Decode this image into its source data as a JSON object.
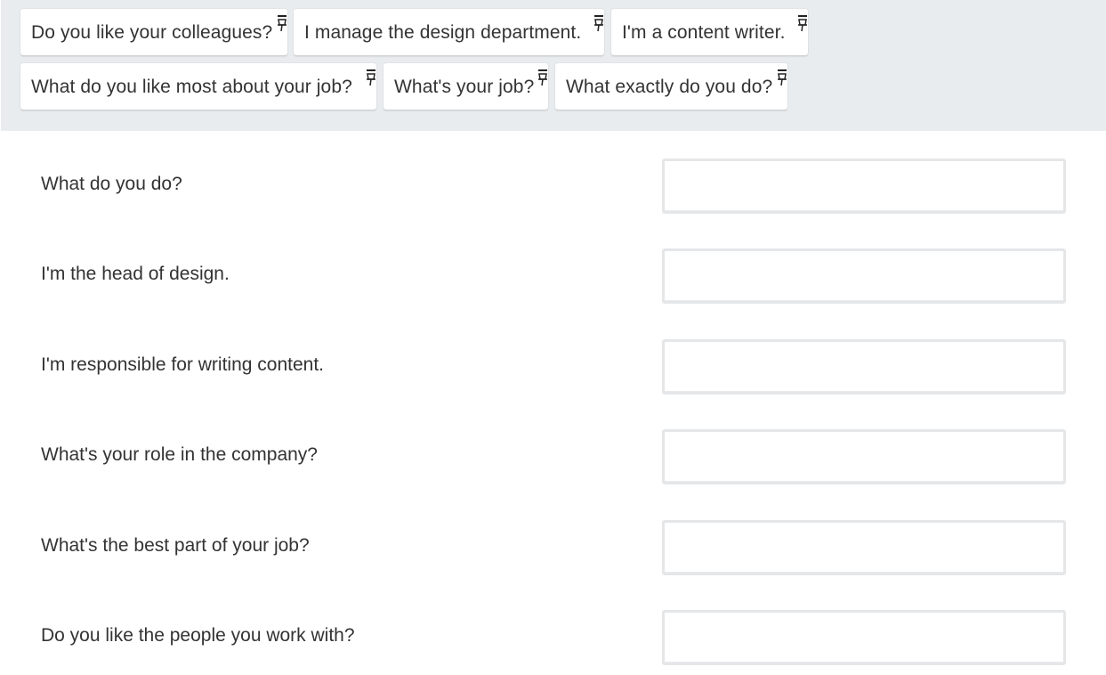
{
  "word_bank": {
    "chips": [
      {
        "text": "Do you like your colleagues?"
      },
      {
        "text": "I manage the design department."
      },
      {
        "text": "I'm a content writer."
      },
      {
        "text": "What do you like most about your job?"
      },
      {
        "text": "What's your job?"
      },
      {
        "text": "What exactly do you do?"
      }
    ],
    "pin_icon": "pin-icon"
  },
  "matching": {
    "rows": [
      {
        "prompt": "What do you do?",
        "answer": ""
      },
      {
        "prompt": "I'm the head of design.",
        "answer": ""
      },
      {
        "prompt": "I'm responsible for writing content.",
        "answer": ""
      },
      {
        "prompt": "What's your role in the company?",
        "answer": ""
      },
      {
        "prompt": "What's the best part of your job?",
        "answer": ""
      },
      {
        "prompt": "Do you like the people you work with?",
        "answer": ""
      }
    ]
  },
  "colors": {
    "bank_background": "#e9ecee",
    "chip_background": "#ffffff",
    "text": "#333333",
    "dropzone_border": "#e4e6e8"
  }
}
